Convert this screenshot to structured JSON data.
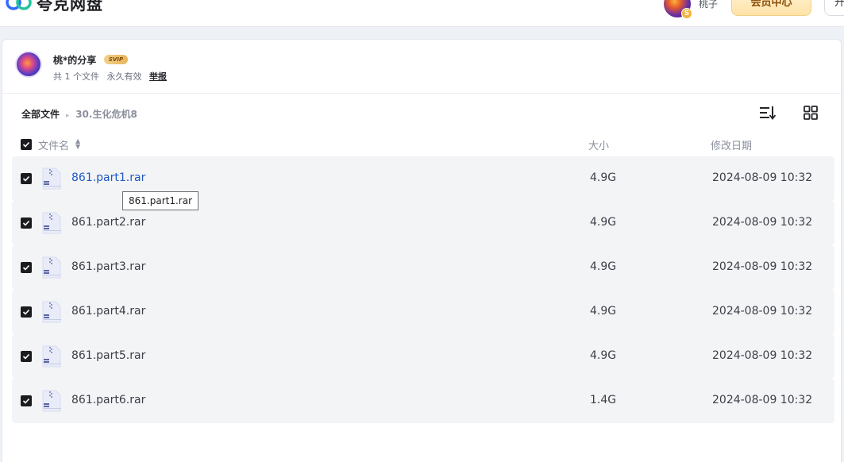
{
  "app": {
    "name": "夸克网盘",
    "username": "桃子",
    "vip_center_label": "会员中心",
    "extra_button_label": "升",
    "avatar_badge": "S"
  },
  "share": {
    "title": "桃*的分享",
    "badge": "SVIP",
    "file_count": "共 1 个文件",
    "validity": "永久有效",
    "report_label": "举报"
  },
  "breadcrumb": {
    "root": "全部文件",
    "separator": "▸",
    "current": "30.生化危机8"
  },
  "columns": {
    "name": "文件名",
    "size": "大小",
    "date": "修改日期"
  },
  "files": [
    {
      "name": "861.part1.rar",
      "size": "4.9G",
      "date": "2024-08-09 10:32"
    },
    {
      "name": "861.part2.rar",
      "size": "4.9G",
      "date": "2024-08-09 10:32"
    },
    {
      "name": "861.part3.rar",
      "size": "4.9G",
      "date": "2024-08-09 10:32"
    },
    {
      "name": "861.part4.rar",
      "size": "4.9G",
      "date": "2024-08-09 10:32"
    },
    {
      "name": "861.part5.rar",
      "size": "4.9G",
      "date": "2024-08-09 10:32"
    },
    {
      "name": "861.part6.rar",
      "size": "1.4G",
      "date": "2024-08-09 10:32"
    }
  ],
  "tooltip": {
    "text": "861.part1.rar"
  },
  "colors": {
    "accent_link": "#1e58c6",
    "row_bg": "#f3f4f6",
    "vip_gold": "#ffe3a8"
  }
}
